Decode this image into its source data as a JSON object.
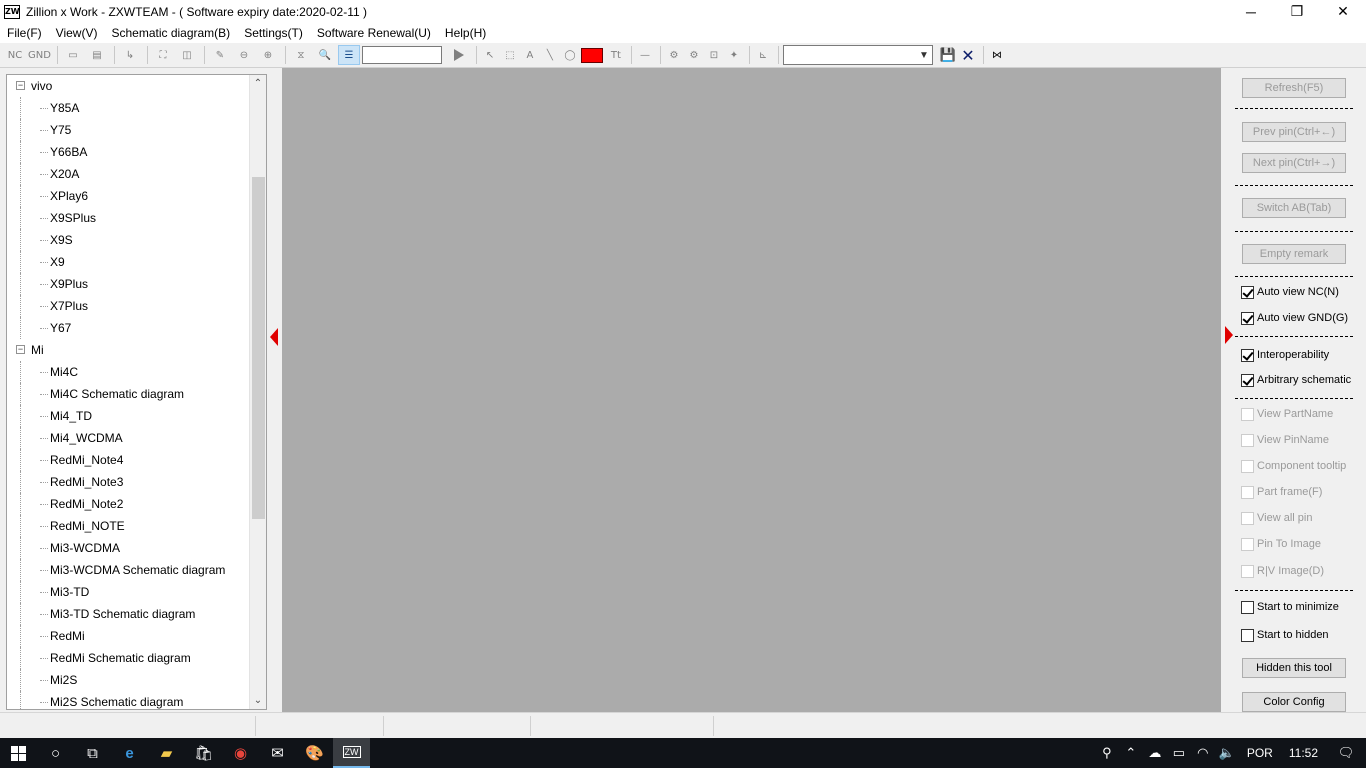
{
  "window": {
    "app_icon": "ZW",
    "title": "Zillion x Work - ZXWTEAM - ( Software expiry date:2020-02-11 )",
    "minimize_glyph": "─",
    "maximize_glyph": "❐",
    "close_glyph": "✕"
  },
  "menu": [
    "File(F)",
    "View(V)",
    "Schematic diagram(B)",
    "Settings(T)",
    "Software Renewal(U)",
    "Help(H)"
  ],
  "toolbar": {
    "nc_label": "NC",
    "gnd_label": "GND",
    "icons": [
      "part-icon",
      "board-icon",
      "pin-icon",
      "fit-icon",
      "layout-icon",
      "edit-icon",
      "zoom-out-icon",
      "zoom-in-icon",
      "filter-icon",
      "search-icon",
      "list-icon"
    ],
    "search_value": "",
    "color_value": "#ff0000",
    "combo_value": ""
  },
  "tree": {
    "groups": [
      {
        "label": "vivo",
        "expander": "−",
        "items": [
          "Y85A",
          "Y75",
          "Y66BA",
          "X20A",
          "XPlay6",
          "X9SPlus",
          "X9S",
          "X9",
          "X9Plus",
          "X7Plus",
          "Y67"
        ]
      },
      {
        "label": "Mi",
        "expander": "−",
        "items": [
          "Mi4C",
          "Mi4C Schematic diagram",
          "Mi4_TD",
          "Mi4_WCDMA",
          "RedMi_Note4",
          "RedMi_Note3",
          "RedMi_Note2",
          "RedMi_NOTE",
          "Mi3-WCDMA",
          "Mi3-WCDMA Schematic diagram",
          "Mi3-TD",
          "Mi3-TD Schematic diagram",
          "RedMi",
          "RedMi Schematic diagram",
          "Mi2S",
          "Mi2S Schematic diagram"
        ]
      }
    ],
    "scroll_up": "⌃",
    "scroll_down": "⌄"
  },
  "right_panel": {
    "refresh": "Refresh(F5)",
    "prev_pin": "Prev pin(Ctrl+←)",
    "next_pin": "Next pin(Ctrl+→)",
    "switch_ab": "Switch AB(Tab)",
    "empty_remark": "Empty remark",
    "auto_view_nc": "Auto view NC(N)",
    "auto_view_gnd": "Auto view GND(G)",
    "interoperability": "Interoperability",
    "arbitrary_schematic": "Arbitrary schematic",
    "view_partname": "View PartName",
    "view_pinname": "View PinName",
    "component_tooltip": "Component tooltip",
    "part_frame": "Part frame(F)",
    "view_all_pin": "View all pin",
    "pin_to_image": "Pin To Image",
    "rv_image": "R|V Image(D)",
    "start_minimize": "Start to minimize",
    "start_hidden": "Start to hidden",
    "hidden_tool": "Hidden this tool",
    "color_config": "Color Config"
  },
  "taskbar": {
    "language": "POR",
    "time": "11:52",
    "app_label": "ZW"
  }
}
